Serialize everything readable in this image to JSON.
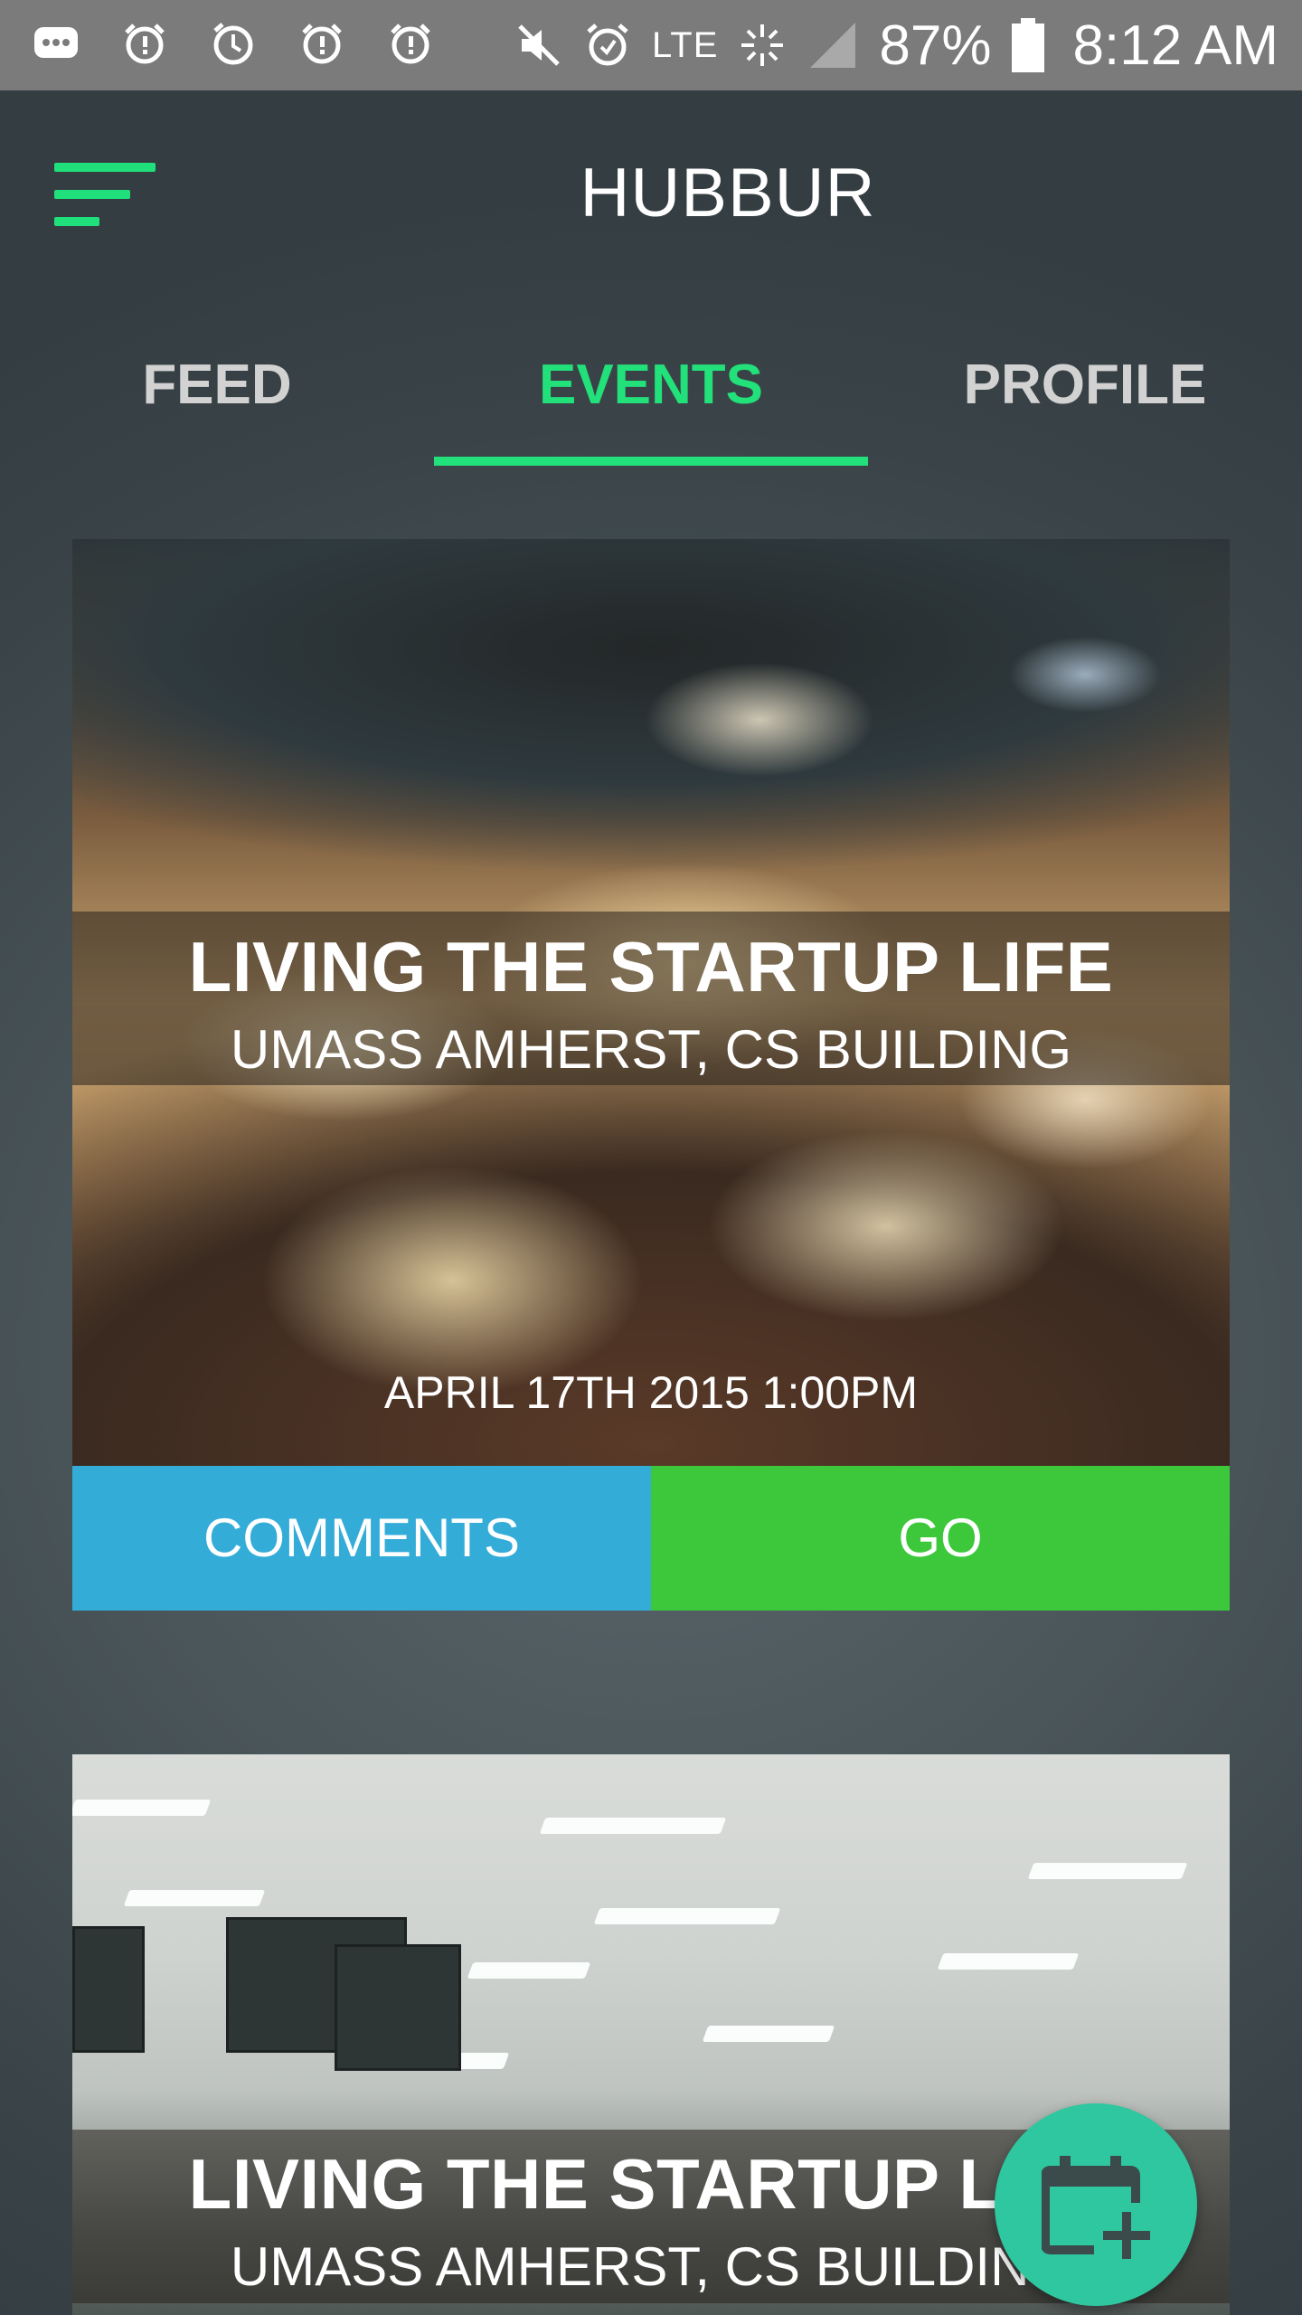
{
  "status_bar": {
    "network": "LTE",
    "battery": "87%",
    "time": "8:12 AM"
  },
  "header": {
    "title": "HUBBUR"
  },
  "tabs": [
    {
      "label": "FEED",
      "active": false
    },
    {
      "label": "EVENTS",
      "active": true
    },
    {
      "label": "PROFILE",
      "active": false
    }
  ],
  "events": [
    {
      "title": "LIVING THE STARTUP LIFE",
      "location": "UMASS AMHERST, CS BUILDING",
      "date": "APRIL 17TH 2015 1:00PM",
      "comments_label": "COMMENTS",
      "go_label": "GO"
    },
    {
      "title": "LIVING THE STARTUP LIFE",
      "location": "UMASS AMHERST, CS BUILDING"
    }
  ],
  "colors": {
    "accent": "#22e07a",
    "comments_button": "#34acd8",
    "go_button": "#3cc83a",
    "fab": "#2ec79f"
  },
  "fab": {
    "icon": "calendar-add-icon"
  }
}
